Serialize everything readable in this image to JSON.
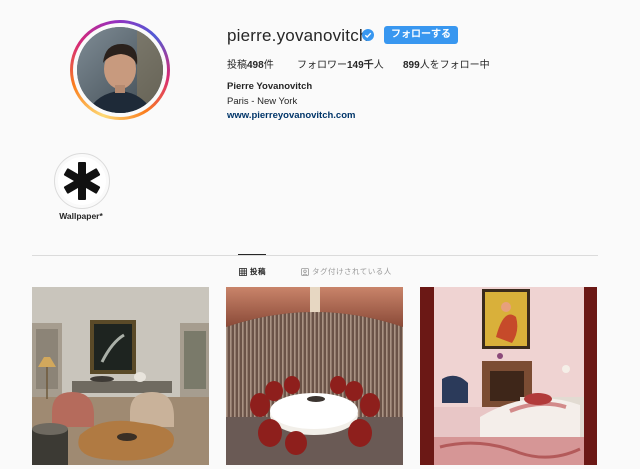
{
  "profile": {
    "username": "pierre.yovanovitch",
    "verified": true,
    "follow_label": "フォローする",
    "stats": {
      "posts_prefix": "投稿",
      "posts_count": "498",
      "posts_suffix": "件",
      "followers_prefix": "フォロワー",
      "followers_count": "149千",
      "followers_suffix": "人",
      "following_count": "899",
      "following_suffix": "人をフォロー中"
    },
    "full_name": "Pierre Yovanovitch",
    "location": "Paris - New York",
    "website": "www.pierreyovanovitch.com"
  },
  "highlights": [
    {
      "label": "Wallpaper*",
      "icon": "asterisk-logo"
    }
  ],
  "tabs": [
    {
      "label": "投稿",
      "icon": "grid-icon",
      "active": true
    },
    {
      "label": "タグ付けされている人",
      "icon": "tag-icon",
      "active": false
    }
  ],
  "posts": [
    {
      "subject": "salon-interior",
      "icon": "photo"
    },
    {
      "subject": "round-dining-room",
      "icon": "photo"
    },
    {
      "subject": "pink-bedroom",
      "icon": "photo"
    }
  ],
  "colors": {
    "accent": "#3897f0",
    "link": "#003569",
    "text": "#262626",
    "muted": "#999999"
  }
}
